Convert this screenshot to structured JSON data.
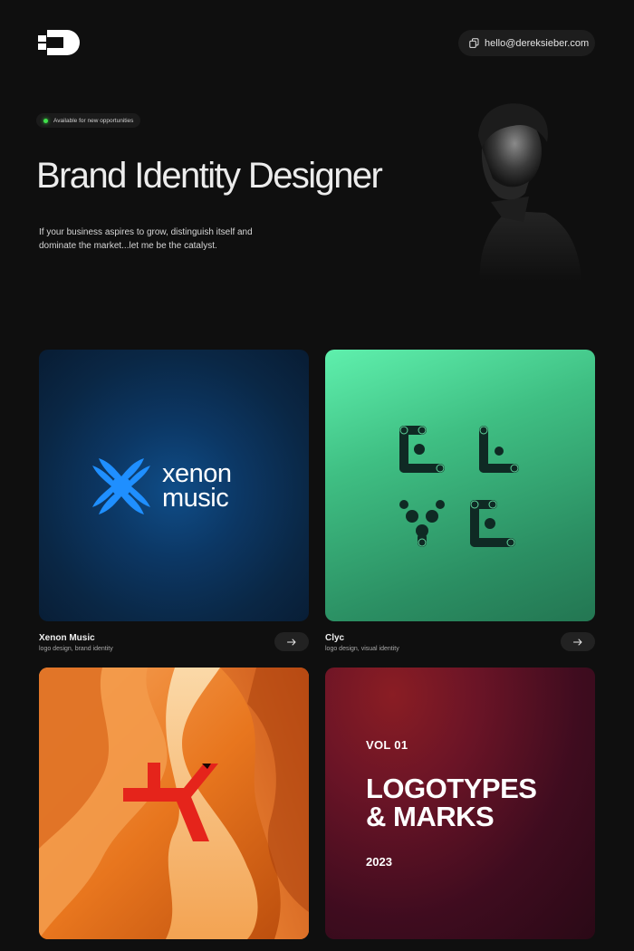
{
  "header": {
    "logo_icon": "d-monogram-logo",
    "email": "hello@dereksieber.com",
    "email_icon": "copy-icon"
  },
  "hero": {
    "status": "Available for new opportunities",
    "status_color": "#3fe04a",
    "title": "Brand Identity Designer",
    "subtitle": "If your business aspires to grow, distinguish itself and dominate the market...let me be the catalyst."
  },
  "projects": [
    {
      "title": "Xenon Music",
      "tags": "logo design, brand identity",
      "logo_text_line1": "xenon",
      "logo_text_line2": "music",
      "accent": "#1f8fff"
    },
    {
      "title": "Clyc",
      "tags": "logo design, visual identity",
      "accent": "#3fbf83"
    },
    {
      "title": "",
      "tags": "",
      "accent": "#e06b14"
    },
    {
      "vol": "VOL 01",
      "title_line1": "LOGOTYPES",
      "title_line2": "& MARKS",
      "year": "2023",
      "accent": "#6a1426"
    }
  ]
}
